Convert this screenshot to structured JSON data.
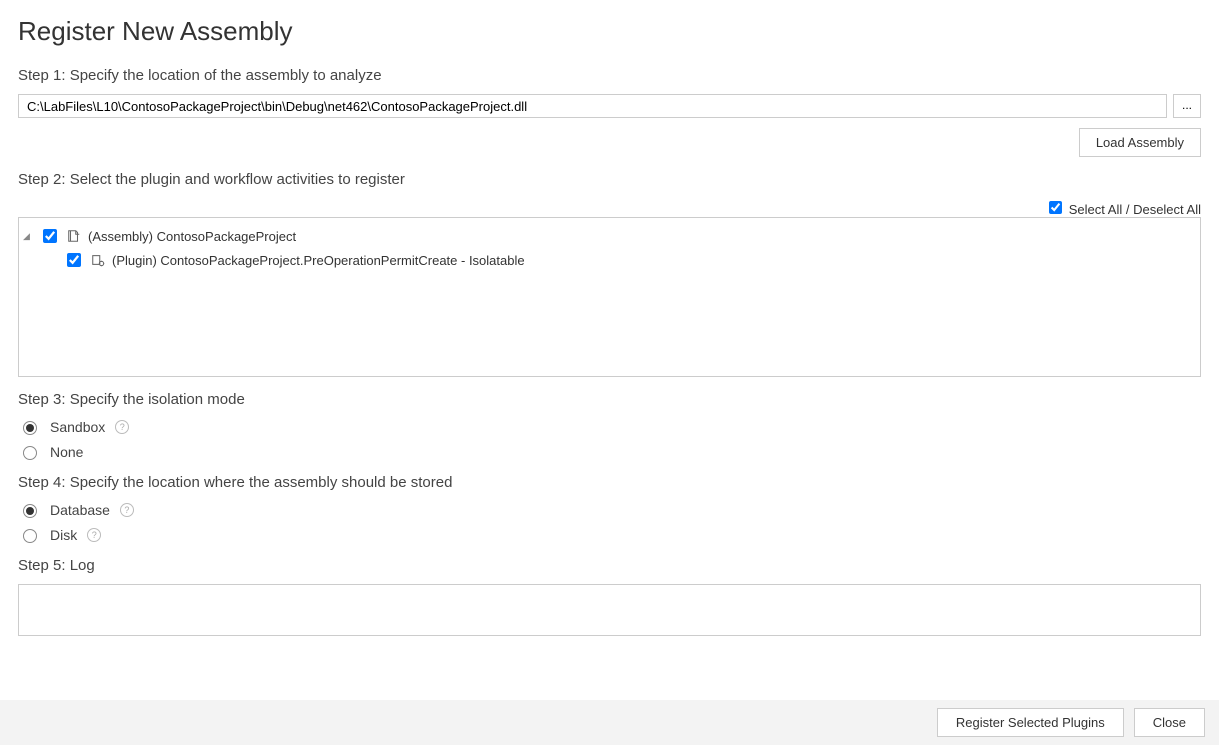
{
  "title": "Register New Assembly",
  "step1": {
    "label": "Step 1: Specify the location of the assembly to analyze",
    "path": "C:\\LabFiles\\L10\\ContosoPackageProject\\bin\\Debug\\net462\\ContosoPackageProject.dll",
    "browse_label": "...",
    "load_button": "Load Assembly"
  },
  "step2": {
    "label": "Step 2: Select the plugin and workflow activities to register",
    "select_all_label": "Select All / Deselect All",
    "select_all_checked": true,
    "tree": {
      "assembly": {
        "checked": true,
        "label": "(Assembly) ContosoPackageProject"
      },
      "plugin": {
        "checked": true,
        "label": "(Plugin) ContosoPackageProject.PreOperationPermitCreate - Isolatable"
      }
    }
  },
  "step3": {
    "label": "Step 3: Specify the isolation mode",
    "options": {
      "sandbox": {
        "label": "Sandbox",
        "checked": true,
        "help": true
      },
      "none": {
        "label": "None",
        "checked": false,
        "help": false
      }
    }
  },
  "step4": {
    "label": "Step 4: Specify the location where the assembly should be stored",
    "options": {
      "database": {
        "label": "Database",
        "checked": true,
        "help": true
      },
      "disk": {
        "label": "Disk",
        "checked": false,
        "help": true
      }
    }
  },
  "step5": {
    "label": "Step 5: Log",
    "log_text": ""
  },
  "footer": {
    "register_button": "Register Selected Plugins",
    "close_button": "Close"
  }
}
